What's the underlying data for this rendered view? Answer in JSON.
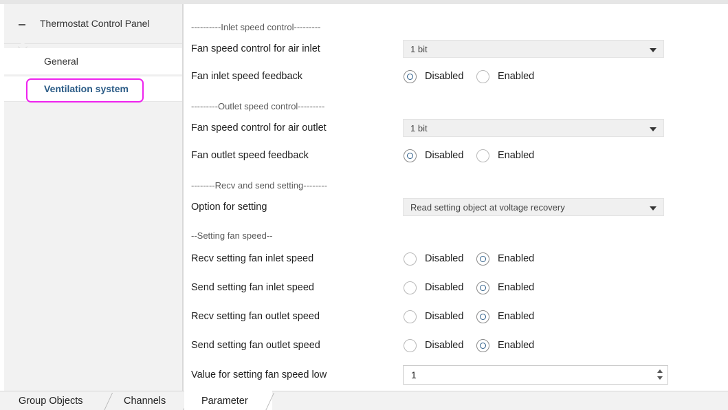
{
  "sidebar": {
    "title": "Thermostat Control Panel",
    "items": [
      {
        "label": "General"
      },
      {
        "label": "Ventilation system",
        "selected": true
      }
    ],
    "highlight_color": "#ee22ee",
    "selected_color": "#2a5b86"
  },
  "params": {
    "inlet_section": "----------Inlet speed control---------",
    "fan_inlet_control": {
      "label": "Fan speed control for air inlet",
      "value": "1 bit"
    },
    "fan_inlet_feedback": {
      "label": "Fan inlet speed feedback",
      "options": [
        "Disabled",
        "Enabled"
      ],
      "selected": "Disabled"
    },
    "outlet_section": "---------Outlet speed control---------",
    "fan_outlet_control": {
      "label": "Fan speed control for air outlet",
      "value": "1 bit"
    },
    "fan_outlet_feedback": {
      "label": "Fan outlet speed feedback",
      "options": [
        "Disabled",
        "Enabled"
      ],
      "selected": "Disabled"
    },
    "recv_send_section": "--------Recv and send setting--------",
    "option_setting": {
      "label": "Option for setting",
      "value": "Read setting object at voltage recovery"
    },
    "fan_speed_section": "--Setting fan speed--",
    "recv_inlet": {
      "label": "Recv setting fan inlet speed",
      "options": [
        "Disabled",
        "Enabled"
      ],
      "selected": "Enabled"
    },
    "send_inlet": {
      "label": "Send setting fan inlet speed",
      "options": [
        "Disabled",
        "Enabled"
      ],
      "selected": "Enabled"
    },
    "recv_outlet": {
      "label": "Recv setting fan outlet speed",
      "options": [
        "Disabled",
        "Enabled"
      ],
      "selected": "Enabled"
    },
    "send_outlet": {
      "label": "Send setting fan outlet speed",
      "options": [
        "Disabled",
        "Enabled"
      ],
      "selected": "Enabled"
    },
    "speed_low": {
      "label": "Value for setting fan speed low",
      "value": "1"
    }
  },
  "tabs": [
    {
      "label": "Group Objects"
    },
    {
      "label": "Channels"
    },
    {
      "label": "Parameter",
      "active": true
    }
  ]
}
